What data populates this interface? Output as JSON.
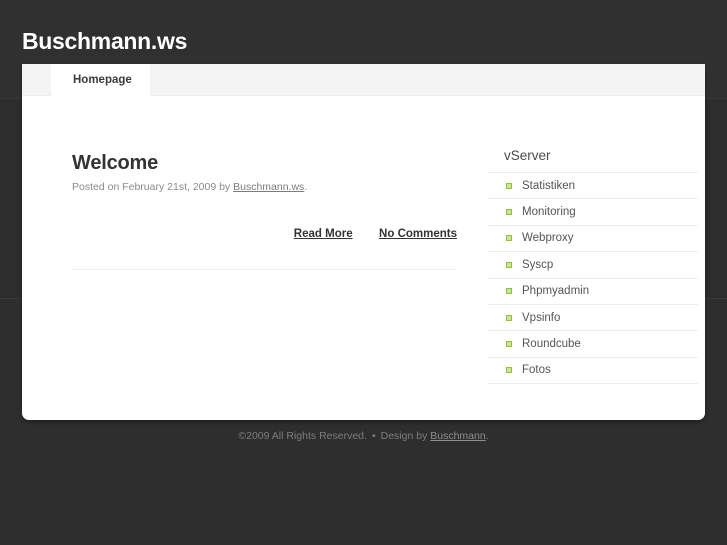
{
  "site": {
    "title": "Buschmann.ws"
  },
  "tabs": [
    {
      "label": "Homepage",
      "active": true
    }
  ],
  "post": {
    "title": "Welcome",
    "meta_prefix": "Posted on February 21st, 2009 by ",
    "meta_author": "Buschmann.ws",
    "meta_suffix": ".",
    "read_more_label": "Read More",
    "comments_label": "No Comments"
  },
  "sidebar": {
    "heading": "vServer",
    "items": [
      {
        "label": "Statistiken"
      },
      {
        "label": "Monitoring"
      },
      {
        "label": "Webproxy"
      },
      {
        "label": "Syscp"
      },
      {
        "label": "Phpmyadmin"
      },
      {
        "label": "Vpsinfo"
      },
      {
        "label": "Roundcube"
      },
      {
        "label": "Fotos"
      }
    ],
    "bullet_fill": "#c8e39a",
    "bullet_border": "#8fbf3d"
  },
  "footer": {
    "copyright": "©2009 All Rights Reserved.",
    "separator": "•",
    "design_prefix": "Design by ",
    "design_link": "Buschmann",
    "design_suffix": "."
  },
  "colors": {
    "page_background": "#2f2f2f",
    "card_background": "#ffffff",
    "tabbar_background": "#f4f4f4",
    "accent_green": "#8fbf3d"
  }
}
